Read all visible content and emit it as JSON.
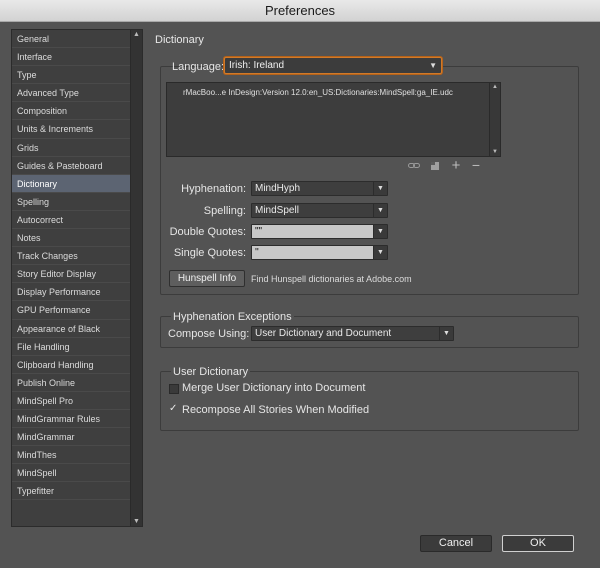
{
  "window": {
    "title": "Preferences"
  },
  "sidebar": {
    "items": [
      "General",
      "Interface",
      "Type",
      "Advanced Type",
      "Composition",
      "Units & Increments",
      "Grids",
      "Guides & Pasteboard",
      "Dictionary",
      "Spelling",
      "Autocorrect",
      "Notes",
      "Track Changes",
      "Story Editor Display",
      "Display Performance",
      "GPU Performance",
      "Appearance of Black",
      "File Handling",
      "Clipboard Handling",
      "Publish Online",
      "MindSpell Pro",
      "MindGrammar Rules",
      "MindGrammar",
      "MindThes",
      "MindSpell",
      "Typefitter"
    ],
    "selected": "Dictionary"
  },
  "main": {
    "title": "Dictionary",
    "language": {
      "label": "Language:",
      "value": "Irish: Ireland"
    },
    "dictionary_list": [
      "rMacBoo...e InDesign:Version 12.0:en_US:Dictionaries:MindSpell:ga_IE.udc"
    ],
    "hyphenation": {
      "label": "Hyphenation:",
      "value": "MindHyph"
    },
    "spelling": {
      "label": "Spelling:",
      "value": "MindSpell"
    },
    "double_quotes": {
      "label": "Double Quotes:",
      "value": "\"\""
    },
    "single_quotes": {
      "label": "Single Quotes:",
      "value": "''"
    },
    "hunspell_button": "Hunspell Info",
    "hunspell_note": "Find Hunspell dictionaries at Adobe.com",
    "hyph_exceptions": {
      "title": "Hyphenation Exceptions",
      "compose_label": "Compose Using:",
      "compose_value": "User Dictionary and Document"
    },
    "user_dictionary": {
      "title": "User Dictionary",
      "merge_label": "Merge User Dictionary into Document",
      "merge_checked": false,
      "recompose_label": "Recompose All Stories When Modified",
      "recompose_checked": true
    }
  },
  "footer": {
    "cancel": "Cancel",
    "ok": "OK"
  },
  "icons": [
    "link-icon",
    "new-dictionary-icon",
    "add-icon",
    "remove-icon",
    "chevron-down-icon"
  ]
}
